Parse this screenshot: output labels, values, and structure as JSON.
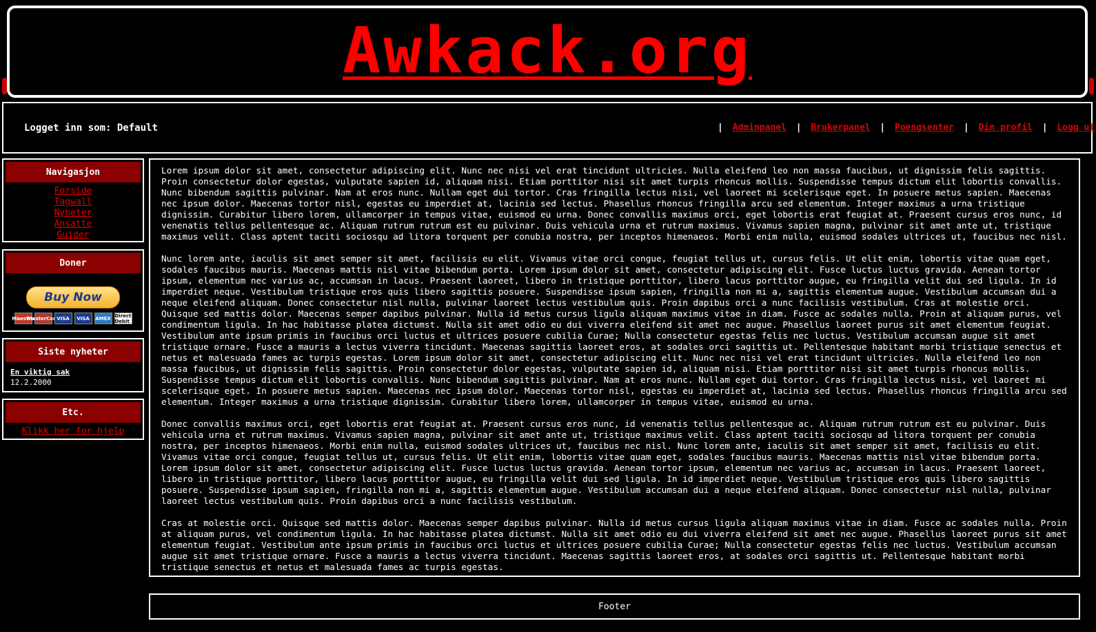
{
  "header": {
    "logo_text": "Awkack.org"
  },
  "userbar": {
    "logged_in_label": "Logget inn som:",
    "username": "Default",
    "links": [
      "Adminpanel",
      "Brukerpanel",
      "Poengsenter",
      "Din profil",
      "Logg ut"
    ],
    "separator": "|"
  },
  "sidebar": {
    "nav": {
      "title": "Navigasjon",
      "items": [
        "Forside",
        "Tagwall",
        "Nyheter",
        "Ansatte",
        "Guider"
      ]
    },
    "donate": {
      "title": "Doner",
      "button_label": "Buy Now",
      "cards": [
        "Maestro",
        "MasterCard",
        "VISA",
        "VISA",
        "AMEX",
        "Direct Debit"
      ]
    },
    "news": {
      "title": "Siste nyheter",
      "item_title": "En viktig sak",
      "item_date": "12.2.2000"
    },
    "etc": {
      "title": "Etc.",
      "help_link": "Klikk her for hjelp"
    }
  },
  "main": {
    "paragraphs": [
      "Lorem ipsum dolor sit amet, consectetur adipiscing elit. Nunc nec nisi vel erat tincidunt ultricies. Nulla eleifend leo non massa faucibus, ut dignissim felis sagittis. Proin consectetur dolor egestas, vulputate sapien id, aliquam nisi. Etiam porttitor nisi sit amet turpis rhoncus mollis. Suspendisse tempus dictum elit lobortis convallis. Nunc bibendum sagittis pulvinar. Nam at eros nunc. Nullam eget dui tortor. Cras fringilla lectus nisi, vel laoreet mi scelerisque eget. In posuere metus sapien. Maecenas nec ipsum dolor. Maecenas tortor nisl, egestas eu imperdiet at, lacinia sed lectus. Phasellus rhoncus fringilla arcu sed elementum. Integer maximus a urna tristique dignissim. Curabitur libero lorem, ullamcorper in tempus vitae, euismod eu urna. Donec convallis maximus orci, eget lobortis erat feugiat at. Praesent cursus eros nunc, id venenatis tellus pellentesque ac. Aliquam rutrum rutrum est eu pulvinar. Duis vehicula urna et rutrum maximus. Vivamus sapien magna, pulvinar sit amet ante ut, tristique maximus velit. Class aptent taciti sociosqu ad litora torquent per conubia nostra, per inceptos himenaeos. Morbi enim nulla, euismod sodales ultrices ut, faucibus nec nisl.",
      "Nunc lorem ante, iaculis sit amet semper sit amet, facilisis eu elit. Vivamus vitae orci congue, feugiat tellus ut, cursus felis. Ut elit enim, lobortis vitae quam eget, sodales faucibus mauris. Maecenas mattis nisl vitae bibendum porta. Lorem ipsum dolor sit amet, consectetur adipiscing elit. Fusce luctus luctus gravida. Aenean tortor ipsum, elementum nec varius ac, accumsan in lacus. Praesent laoreet, libero in tristique porttitor, libero lacus porttitor augue, eu fringilla velit dui sed ligula. In id imperdiet neque. Vestibulum tristique eros quis libero sagittis posuere. Suspendisse ipsum sapien, fringilla non mi a, sagittis elementum augue. Vestibulum accumsan dui a neque eleifend aliquam. Donec consectetur nisl nulla, pulvinar laoreet lectus vestibulum quis. Proin dapibus orci a nunc facilisis vestibulum. Cras at molestie orci. Quisque sed mattis dolor. Maecenas semper dapibus pulvinar. Nulla id metus cursus ligula aliquam maximus vitae in diam. Fusce ac sodales nulla. Proin at aliquam purus, vel condimentum ligula. In hac habitasse platea dictumst. Nulla sit amet odio eu dui viverra eleifend sit amet nec augue. Phasellus laoreet purus sit amet elementum feugiat. Vestibulum ante ipsum primis in faucibus orci luctus et ultrices posuere cubilia Curae; Nulla consectetur egestas felis nec luctus. Vestibulum accumsan augue sit amet tristique ornare. Fusce a mauris a lectus viverra tincidunt. Maecenas sagittis laoreet eros, at sodales orci sagittis ut. Pellentesque habitant morbi tristique senectus et netus et malesuada fames ac turpis egestas. Lorem ipsum dolor sit amet, consectetur adipiscing elit. Nunc nec nisi vel erat tincidunt ultricies. Nulla eleifend leo non massa faucibus, ut dignissim felis sagittis. Proin consectetur dolor egestas, vulputate sapien id, aliquam nisi. Etiam porttitor nisi sit amet turpis rhoncus mollis. Suspendisse tempus dictum elit lobortis convallis. Nunc bibendum sagittis pulvinar. Nam at eros nunc. Nullam eget dui tortor. Cras fringilla lectus nisi, vel laoreet mi scelerisque eget. In posuere metus sapien. Maecenas nec ipsum dolor. Maecenas tortor nisl, egestas eu imperdiet at, lacinia sed lectus. Phasellus rhoncus fringilla arcu sed elementum. Integer maximus a urna tristique dignissim. Curabitur libero lorem, ullamcorper in tempus vitae, euismod eu urna.",
      "Donec convallis maximus orci, eget lobortis erat feugiat at. Praesent cursus eros nunc, id venenatis tellus pellentesque ac. Aliquam rutrum rutrum est eu pulvinar. Duis vehicula urna et rutrum maximus. Vivamus sapien magna, pulvinar sit amet ante ut, tristique maximus velit. Class aptent taciti sociosqu ad litora torquent per conubia nostra, per inceptos himenaeos. Morbi enim nulla, euismod sodales ultrices ut, faucibus nec nisl. Nunc lorem ante, iaculis sit amet semper sit amet, facilisis eu elit. Vivamus vitae orci congue, feugiat tellus ut, cursus felis. Ut elit enim, lobortis vitae quam eget, sodales faucibus mauris. Maecenas mattis nisl vitae bibendum porta. Lorem ipsum dolor sit amet, consectetur adipiscing elit. Fusce luctus luctus gravida. Aenean tortor ipsum, elementum nec varius ac, accumsan in lacus. Praesent laoreet, libero in tristique porttitor, libero lacus porttitor augue, eu fringilla velit dui sed ligula. In id imperdiet neque. Vestibulum tristique eros quis libero sagittis posuere. Suspendisse ipsum sapien, fringilla non mi a, sagittis elementum augue. Vestibulum accumsan dui a neque eleifend aliquam. Donec consectetur nisl nulla, pulvinar laoreet lectus vestibulum quis. Proin dapibus orci a nunc facilisis vestibulum.",
      "Cras at molestie orci. Quisque sed mattis dolor. Maecenas semper dapibus pulvinar. Nulla id metus cursus ligula aliquam maximus vitae in diam. Fusce ac sodales nulla. Proin at aliquam purus, vel condimentum ligula. In hac habitasse platea dictumst. Nulla sit amet odio eu dui viverra eleifend sit amet nec augue. Phasellus laoreet purus sit amet elementum feugiat. Vestibulum ante ipsum primis in faucibus orci luctus et ultrices posuere cubilia Curae; Nulla consectetur egestas felis nec luctus. Vestibulum accumsan augue sit amet tristique ornare. Fusce a mauris a lectus viverra tincidunt. Maecenas sagittis laoreet eros, at sodales orci sagittis ut. Pellentesque habitant morbi tristique senectus et netus et malesuada fames ac turpis egestas."
    ]
  },
  "footer": {
    "text": "Footer"
  },
  "colors": {
    "background": "#000000",
    "accent_red": "#ff0000",
    "header_red": "#8b0000",
    "text": "#ffffff"
  }
}
